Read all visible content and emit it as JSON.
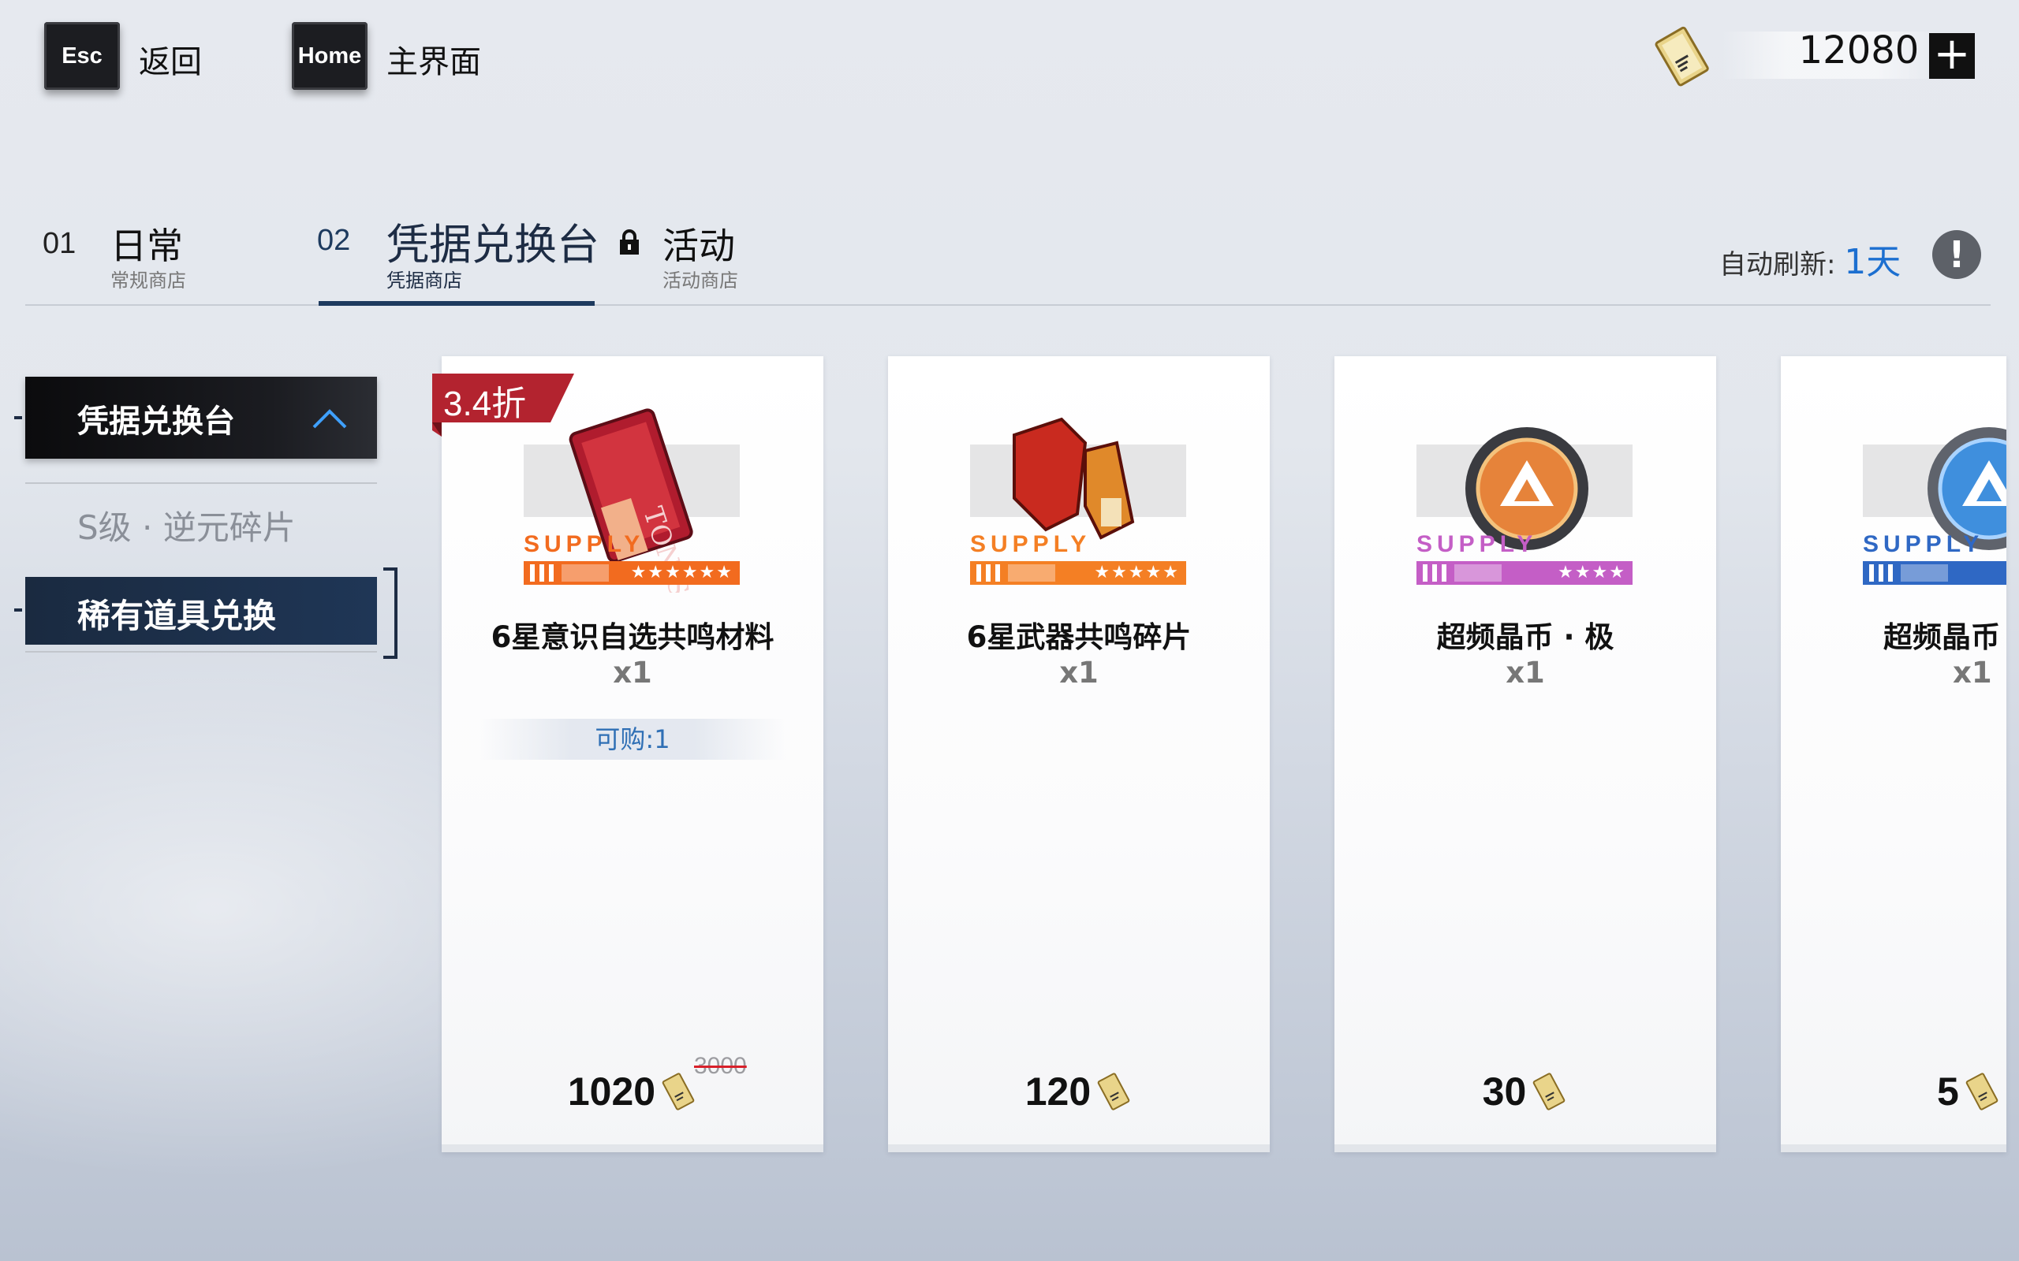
{
  "header": {
    "back_key": "Esc",
    "back_label": "返回",
    "home_key": "Home",
    "home_label": "主界面",
    "currency_value": "12080",
    "currency_icon": "voucher-ticket-icon",
    "add_icon": "plus-icon"
  },
  "tabs": [
    {
      "num": "01",
      "title": "日常",
      "subtitle": "常规商店"
    },
    {
      "num": "02",
      "title": "凭据兑换台",
      "subtitle": "凭据商店"
    },
    {
      "title": "活动",
      "subtitle": "活动商店",
      "locked": true
    }
  ],
  "refresh": {
    "label": "自动刷新:",
    "value": "1天",
    "info_icon": "exclamation-icon"
  },
  "sidebar": {
    "header_label": "凭据兑换台",
    "items": [
      {
        "label": "S级 · 逆元碎片"
      },
      {
        "label": "稀有道具兑换"
      }
    ]
  },
  "products": [
    {
      "name": "6星意识自选共鸣材料",
      "qty": "x1",
      "limit": "可购:1",
      "price": "1020",
      "old_price": "3000",
      "discount": "3.4折",
      "supply": "SUPPLY",
      "stars": "★★★★★★",
      "color": "#f26b1f",
      "icon": "memory-card-icon"
    },
    {
      "name": "6星武器共鸣碎片",
      "qty": "x1",
      "price": "120",
      "supply": "SUPPLY",
      "stars": "★★★★★",
      "color": "#f47f24",
      "icon": "weapon-fragment-icon"
    },
    {
      "name": "超频晶币 · 极",
      "qty": "x1",
      "price": "30",
      "supply": "SUPPLY",
      "stars": "★★★★",
      "color": "#c45ec6",
      "icon": "orange-coin-icon"
    },
    {
      "name": "超频晶币",
      "qty": "x1",
      "price": "5",
      "supply": "SUPPLY",
      "color": "#2f68c4",
      "icon": "blue-coin-icon"
    }
  ]
}
